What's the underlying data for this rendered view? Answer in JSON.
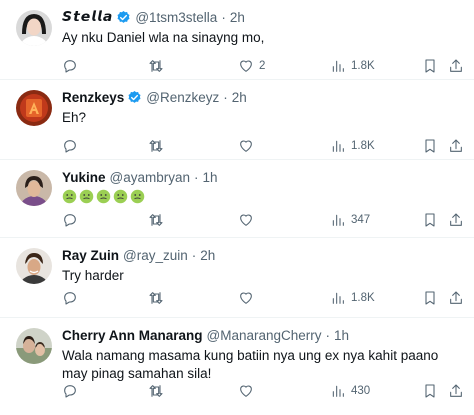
{
  "colors": {
    "verified": "#1d9bf0",
    "secondary_text": "#536471",
    "divider": "#eff3f4"
  },
  "tweets": [
    {
      "name": "𝙎𝙩𝙚𝙡𝙡𝙖",
      "verified": true,
      "handle": "@1tsm3stella",
      "dot": "·",
      "time": "2h",
      "text": "Ay nku Daniel wla na sinayng mo,",
      "likes": "2",
      "views": "1.8K"
    },
    {
      "name": "Renzkeys",
      "verified": true,
      "handle": "@Renzkeyz",
      "dot": "·",
      "time": "2h",
      "text": "Eh?",
      "likes": "",
      "views": "1.8K"
    },
    {
      "name": "Yukine",
      "verified": false,
      "handle": "@ayambryan",
      "dot": "·",
      "time": "1h",
      "emojis": [
        "nauseated-face-emoji",
        "nauseated-face-emoji",
        "nauseated-face-emoji",
        "nauseated-face-emoji",
        "nauseated-face-emoji"
      ],
      "likes": "",
      "views": "347"
    },
    {
      "name": "Ray Zuin",
      "verified": false,
      "handle": "@ray_zuin",
      "dot": "·",
      "time": "2h",
      "text": "Try harder",
      "likes": "",
      "views": "1.8K"
    },
    {
      "name": "Cherry Ann Manarang",
      "verified": false,
      "handle": "@ManarangCherry",
      "dot": "·",
      "time": "1h",
      "text": "Wala namang masama kung batiin nya ung ex nya kahit paano may pinag samahan sila!",
      "likes": "",
      "views": "430"
    }
  ]
}
